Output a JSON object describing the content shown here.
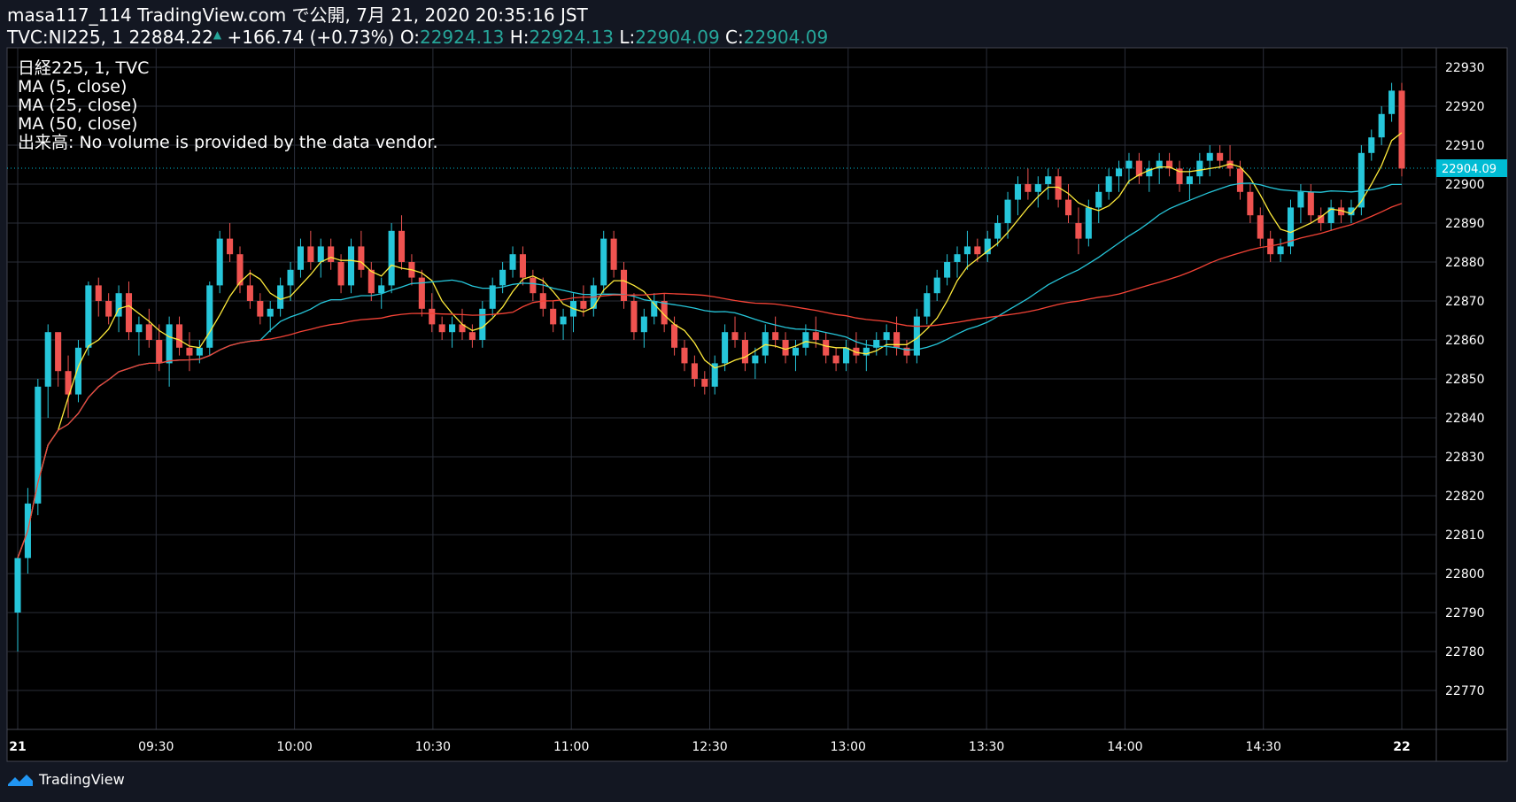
{
  "header": {
    "line1": "masa117_114 TradingView.com で公開, 7月 21, 2020 20:35:16 JST",
    "symbol": "TVC:NI225, 1",
    "price": "22884.22",
    "change": "+166.74 (+0.73%)",
    "o_label": "O:",
    "o": "22924.13",
    "h_label": "H:",
    "h": "22924.13",
    "l_label": "L:",
    "l": "22904.09",
    "c_label": "C:",
    "c": "22904.09"
  },
  "legend": {
    "title": "日経225, 1, TVC",
    "ma5": "MA (5, close)",
    "ma25": "MA (25, close)",
    "ma50": "MA (50, close)",
    "volume": "出来高: No volume is provided by the data vendor."
  },
  "brand": "TradingView",
  "colors": {
    "background": "#000000",
    "frame": "#131722",
    "up": "#26c6da",
    "down": "#ef5350",
    "ma5": "#ffeb3b",
    "ma25": "#26c6da",
    "ma50": "#f44336",
    "grid": "#2a2e39",
    "last": "#00bcd4"
  },
  "chart_data": {
    "type": "candlestick",
    "title": "日経225, 1, TVC",
    "ylim": [
      22760,
      22935
    ],
    "y_ticks": [
      22770,
      22780,
      22790,
      22800,
      22810,
      22820,
      22830,
      22840,
      22850,
      22860,
      22870,
      22880,
      22890,
      22900,
      22910,
      22920,
      22930
    ],
    "x_ticks": [
      {
        "label": "21",
        "t": 0
      },
      {
        "label": "09:30",
        "t": 30
      },
      {
        "label": "10:00",
        "t": 60
      },
      {
        "label": "10:30",
        "t": 90
      },
      {
        "label": "11:00",
        "t": 120
      },
      {
        "label": "12:30",
        "t": 150
      },
      {
        "label": "13:00",
        "t": 180
      },
      {
        "label": "13:30",
        "t": 210
      },
      {
        "label": "14:00",
        "t": 240
      },
      {
        "label": "14:30",
        "t": 270
      },
      {
        "label": "22",
        "t": 300
      }
    ],
    "last_price": "22904.09",
    "last_value": 22904.09,
    "grid": true,
    "ohlc": [
      [
        22790,
        22804,
        22780,
        22804
      ],
      [
        22804,
        22822,
        22800,
        22818
      ],
      [
        22818,
        22850,
        22815,
        22848
      ],
      [
        22848,
        22864,
        22840,
        22862
      ],
      [
        22862,
        22858,
        22848,
        22852
      ],
      [
        22852,
        22856,
        22840,
        22846
      ],
      [
        22846,
        22860,
        22844,
        22858
      ],
      [
        22858,
        22875,
        22856,
        22874
      ],
      [
        22874,
        22876,
        22866,
        22870
      ],
      [
        22870,
        22872,
        22864,
        22866
      ],
      [
        22866,
        22874,
        22862,
        22872
      ],
      [
        22872,
        22875,
        22860,
        22862
      ],
      [
        22862,
        22866,
        22856,
        22864
      ],
      [
        22864,
        22868,
        22858,
        22860
      ],
      [
        22860,
        22864,
        22852,
        22854
      ],
      [
        22854,
        22866,
        22848,
        22864
      ],
      [
        22864,
        22866,
        22856,
        22858
      ],
      [
        22858,
        22862,
        22852,
        22856
      ],
      [
        22856,
        22860,
        22854,
        22858
      ],
      [
        22858,
        22875,
        22856,
        22874
      ],
      [
        22874,
        22888,
        22872,
        22886
      ],
      [
        22886,
        22890,
        22880,
        22882
      ],
      [
        22882,
        22884,
        22872,
        22874
      ],
      [
        22874,
        22878,
        22868,
        22870
      ],
      [
        22870,
        22872,
        22864,
        22866
      ],
      [
        22866,
        22870,
        22862,
        22868
      ],
      [
        22868,
        22876,
        22866,
        22874
      ],
      [
        22874,
        22880,
        22870,
        22878
      ],
      [
        22878,
        22886,
        22876,
        22884
      ],
      [
        22884,
        22888,
        22878,
        22880
      ],
      [
        22880,
        22886,
        22876,
        22884
      ],
      [
        22884,
        22886,
        22878,
        22880
      ],
      [
        22880,
        22882,
        22872,
        22874
      ],
      [
        22874,
        22886,
        22872,
        22884
      ],
      [
        22884,
        22888,
        22876,
        22878
      ],
      [
        22878,
        22880,
        22870,
        22872
      ],
      [
        22872,
        22876,
        22868,
        22874
      ],
      [
        22874,
        22890,
        22872,
        22888
      ],
      [
        22888,
        22892,
        22878,
        22880
      ],
      [
        22880,
        22882,
        22874,
        22876
      ],
      [
        22876,
        22878,
        22866,
        22868
      ],
      [
        22868,
        22872,
        22862,
        22864
      ],
      [
        22864,
        22866,
        22860,
        22862
      ],
      [
        22862,
        22866,
        22858,
        22864
      ],
      [
        22864,
        22868,
        22860,
        22862
      ],
      [
        22862,
        22864,
        22858,
        22860
      ],
      [
        22860,
        22870,
        22858,
        22868
      ],
      [
        22868,
        22876,
        22866,
        22874
      ],
      [
        22874,
        22880,
        22872,
        22878
      ],
      [
        22878,
        22884,
        22876,
        22882
      ],
      [
        22882,
        22884,
        22874,
        22876
      ],
      [
        22876,
        22878,
        22870,
        22872
      ],
      [
        22872,
        22876,
        22866,
        22868
      ],
      [
        22868,
        22870,
        22862,
        22864
      ],
      [
        22864,
        22868,
        22860,
        22866
      ],
      [
        22866,
        22872,
        22862,
        22870
      ],
      [
        22870,
        22874,
        22866,
        22868
      ],
      [
        22868,
        22876,
        22866,
        22874
      ],
      [
        22874,
        22888,
        22872,
        22886
      ],
      [
        22886,
        22888,
        22876,
        22878
      ],
      [
        22878,
        22880,
        22868,
        22870
      ],
      [
        22870,
        22872,
        22860,
        22862
      ],
      [
        22862,
        22868,
        22858,
        22866
      ],
      [
        22866,
        22872,
        22864,
        22870
      ],
      [
        22870,
        22872,
        22862,
        22864
      ],
      [
        22864,
        22866,
        22856,
        22858
      ],
      [
        22858,
        22860,
        22852,
        22854
      ],
      [
        22854,
        22856,
        22848,
        22850
      ],
      [
        22850,
        22852,
        22846,
        22848
      ],
      [
        22848,
        22856,
        22846,
        22854
      ],
      [
        22854,
        22864,
        22852,
        22862
      ],
      [
        22862,
        22866,
        22858,
        22860
      ],
      [
        22860,
        22862,
        22852,
        22854
      ],
      [
        22854,
        22858,
        22850,
        22856
      ],
      [
        22856,
        22864,
        22854,
        22862
      ],
      [
        22862,
        22866,
        22858,
        22860
      ],
      [
        22860,
        22862,
        22854,
        22856
      ],
      [
        22856,
        22860,
        22852,
        22858
      ],
      [
        22858,
        22864,
        22856,
        22862
      ],
      [
        22862,
        22866,
        22858,
        22860
      ],
      [
        22860,
        22862,
        22854,
        22856
      ],
      [
        22856,
        22858,
        22852,
        22854
      ],
      [
        22854,
        22860,
        22852,
        22858
      ],
      [
        22858,
        22862,
        22854,
        22856
      ],
      [
        22856,
        22860,
        22852,
        22858
      ],
      [
        22858,
        22862,
        22856,
        22860
      ],
      [
        22860,
        22864,
        22856,
        22862
      ],
      [
        22862,
        22866,
        22856,
        22858
      ],
      [
        22858,
        22860,
        22854,
        22856
      ],
      [
        22856,
        22868,
        22854,
        22866
      ],
      [
        22866,
        22874,
        22864,
        22872
      ],
      [
        22872,
        22878,
        22870,
        22876
      ],
      [
        22876,
        22882,
        22874,
        22880
      ],
      [
        22880,
        22884,
        22876,
        22882
      ],
      [
        22882,
        22888,
        22878,
        22884
      ],
      [
        22884,
        22886,
        22880,
        22882
      ],
      [
        22882,
        22888,
        22880,
        22886
      ],
      [
        22886,
        22892,
        22884,
        22890
      ],
      [
        22890,
        22898,
        22886,
        22896
      ],
      [
        22896,
        22902,
        22892,
        22900
      ],
      [
        22900,
        22904,
        22896,
        22898
      ],
      [
        22898,
        22902,
        22894,
        22900
      ],
      [
        22900,
        22904,
        22896,
        22902
      ],
      [
        22902,
        22904,
        22894,
        22896
      ],
      [
        22896,
        22900,
        22890,
        22892
      ],
      [
        22890,
        22894,
        22882,
        22886
      ],
      [
        22886,
        22896,
        22884,
        22894
      ],
      [
        22894,
        22900,
        22890,
        22898
      ],
      [
        22898,
        22904,
        22896,
        22902
      ],
      [
        22902,
        22906,
        22898,
        22904
      ],
      [
        22904,
        22908,
        22900,
        22906
      ],
      [
        22906,
        22908,
        22900,
        22902
      ],
      [
        22902,
        22906,
        22898,
        22904
      ],
      [
        22904,
        22908,
        22900,
        22906
      ],
      [
        22906,
        22908,
        22902,
        22904
      ],
      [
        22904,
        22906,
        22898,
        22900
      ],
      [
        22900,
        22904,
        22896,
        22902
      ],
      [
        22902,
        22908,
        22900,
        22906
      ],
      [
        22906,
        22910,
        22902,
        22908
      ],
      [
        22908,
        22910,
        22904,
        22906
      ],
      [
        22906,
        22910,
        22902,
        22904
      ],
      [
        22904,
        22906,
        22896,
        22898
      ],
      [
        22898,
        22900,
        22890,
        22892
      ],
      [
        22892,
        22894,
        22884,
        22886
      ],
      [
        22886,
        22888,
        22880,
        22882
      ],
      [
        22882,
        22886,
        22880,
        22884
      ],
      [
        22884,
        22896,
        22882,
        22894
      ],
      [
        22894,
        22900,
        22890,
        22898
      ],
      [
        22898,
        22900,
        22890,
        22892
      ],
      [
        22892,
        22894,
        22888,
        22890
      ],
      [
        22890,
        22896,
        22888,
        22894
      ],
      [
        22894,
        22896,
        22890,
        22892
      ],
      [
        22892,
        22896,
        22890,
        22894
      ],
      [
        22894,
        22910,
        22892,
        22908
      ],
      [
        22908,
        22914,
        22906,
        22912
      ],
      [
        22912,
        22920,
        22910,
        22918
      ],
      [
        22918,
        22926,
        22916,
        22924
      ],
      [
        22924,
        22926,
        22902,
        22904
      ]
    ],
    "series": [
      {
        "name": "MA (5, close)",
        "color": "#ffeb3b",
        "period": 5
      },
      {
        "name": "MA (25, close)",
        "color": "#26c6da",
        "period": 25
      },
      {
        "name": "MA (50, close)",
        "color": "#f44336",
        "period": 50
      }
    ]
  }
}
